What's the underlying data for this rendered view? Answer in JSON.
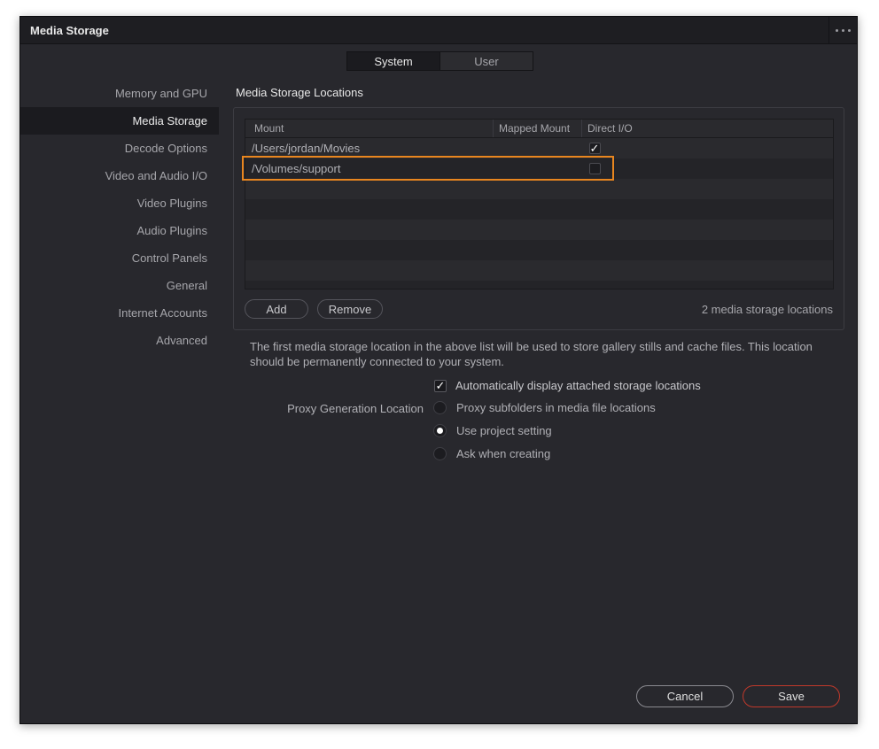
{
  "window": {
    "title": "Media Storage"
  },
  "tabs": [
    {
      "label": "System",
      "active": true
    },
    {
      "label": "User",
      "active": false
    }
  ],
  "sidebar": {
    "items": [
      {
        "label": "Memory and GPU"
      },
      {
        "label": "Media Storage",
        "active": true
      },
      {
        "label": "Decode Options"
      },
      {
        "label": "Video and Audio I/O"
      },
      {
        "label": "Video Plugins"
      },
      {
        "label": "Audio Plugins"
      },
      {
        "label": "Control Panels"
      },
      {
        "label": "General"
      },
      {
        "label": "Internet Accounts"
      },
      {
        "label": "Advanced"
      }
    ]
  },
  "locations": {
    "section_title": "Media Storage Locations",
    "columns": {
      "mount": "Mount",
      "mapped": "Mapped Mount",
      "direct_io": "Direct I/O"
    },
    "rows": [
      {
        "mount": "/Users/jordan/Movies",
        "mapped": "",
        "direct_io": true
      },
      {
        "mount": "/Volumes/support",
        "mapped": "",
        "direct_io": false
      }
    ],
    "add_label": "Add",
    "remove_label": "Remove",
    "count_text": "2 media storage locations",
    "checkmark": "✓"
  },
  "description": "The first media storage location in the above list will be used to store gallery stills and cache files. This location should be permanently connected to your system.",
  "auto_display": {
    "label": "Automatically display attached storage locations",
    "checked": true
  },
  "proxy": {
    "label": "Proxy Generation Location",
    "options": [
      {
        "label": "Proxy subfolders in media file locations",
        "selected": false
      },
      {
        "label": "Use project setting",
        "selected": true
      },
      {
        "label": "Ask when creating",
        "selected": false
      }
    ]
  },
  "footer": {
    "cancel_label": "Cancel",
    "save_label": "Save"
  },
  "colors": {
    "highlight": "#e8861f",
    "save_border": "#c0392b",
    "accent": "#ffffff"
  }
}
